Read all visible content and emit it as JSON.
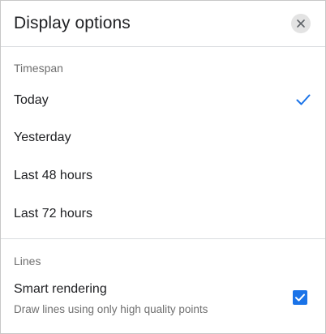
{
  "dialog": {
    "title": "Display options",
    "close_icon": "close-icon"
  },
  "timespan": {
    "label": "Timespan",
    "selected": "Today",
    "options": [
      {
        "label": "Today",
        "checked": true
      },
      {
        "label": "Yesterday",
        "checked": false
      },
      {
        "label": "Last 48 hours",
        "checked": false
      },
      {
        "label": "Last 72 hours",
        "checked": false
      }
    ],
    "check_icon": "check-icon"
  },
  "lines": {
    "label": "Lines",
    "smart_rendering": {
      "title": "Smart rendering",
      "description": "Draw lines using only high quality points",
      "checked": true
    }
  },
  "colors": {
    "accent": "#1a73e8",
    "text_primary": "#202124",
    "text_secondary": "#6f6f6f",
    "divider": "#dadce0",
    "close_button_bg": "#e3e3e3"
  }
}
